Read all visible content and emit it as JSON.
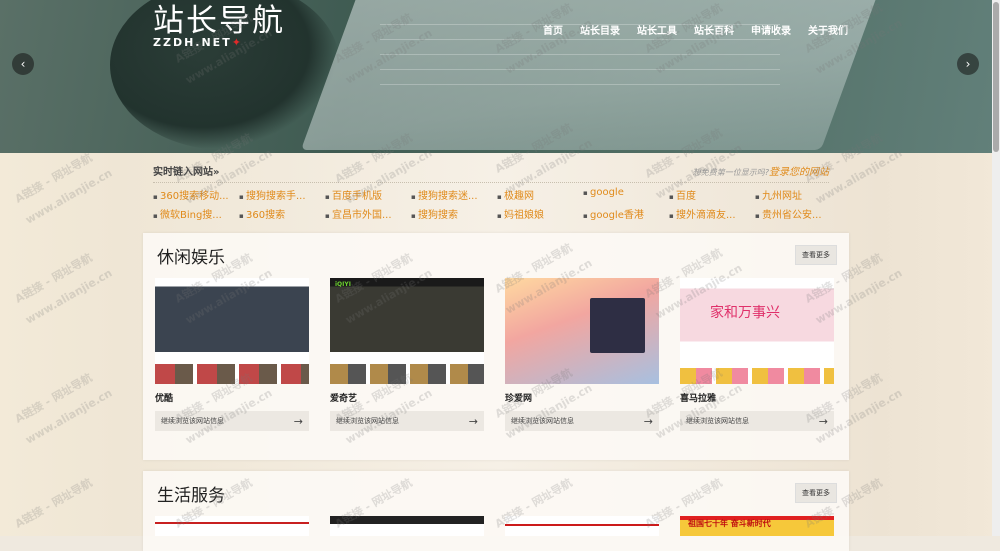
{
  "logo": {
    "main": "站长导航",
    "sub": "ZZDH.NET"
  },
  "nav": [
    "首页",
    "站长目录",
    "站长工具",
    "站长百科",
    "申请收录",
    "关于我们"
  ],
  "carousel": {
    "prev": "‹",
    "next": "›"
  },
  "realtime": {
    "title": "实时链入网站»",
    "ask": "想免费第一位显示吗?",
    "register": "登录您的网站",
    "items": [
      "360搜索移动...",
      "搜狗搜索手...",
      "百度手机版",
      "搜狗搜索迷...",
      "极趣网",
      "google",
      "百度",
      "九州网址",
      "微软Bing搜...",
      "360搜索",
      "宜昌市外国...",
      "搜狗搜索",
      "妈祖娘娘",
      "google香港",
      "搜外滴滴友...",
      "贵州省公安..."
    ]
  },
  "section1": {
    "title": "休闲娱乐",
    "more": "查看更多",
    "cards": [
      {
        "name": "优酷",
        "foot": "继续浏览该网站信息"
      },
      {
        "name": "爱奇艺",
        "foot": "继续浏览该网站信息"
      },
      {
        "name": "珍爱网",
        "foot": "继续浏览该网站信息"
      },
      {
        "name": "喜马拉雅",
        "foot": "继续浏览该网站信息"
      }
    ],
    "thumb_texts": {
      "iqiyi": "iQIYI",
      "ximalaya": "家和万事兴"
    }
  },
  "section2": {
    "title": "生活服务",
    "more": "查看更多",
    "thumb_text": "祖国七十年 奋斗新时代"
  },
  "watermark": {
    "a": "A链接 - 网址导航",
    "b": "www.alianjie.cn"
  },
  "colors": {
    "accent": "#e08a1a",
    "hero": "#4a6a60"
  }
}
